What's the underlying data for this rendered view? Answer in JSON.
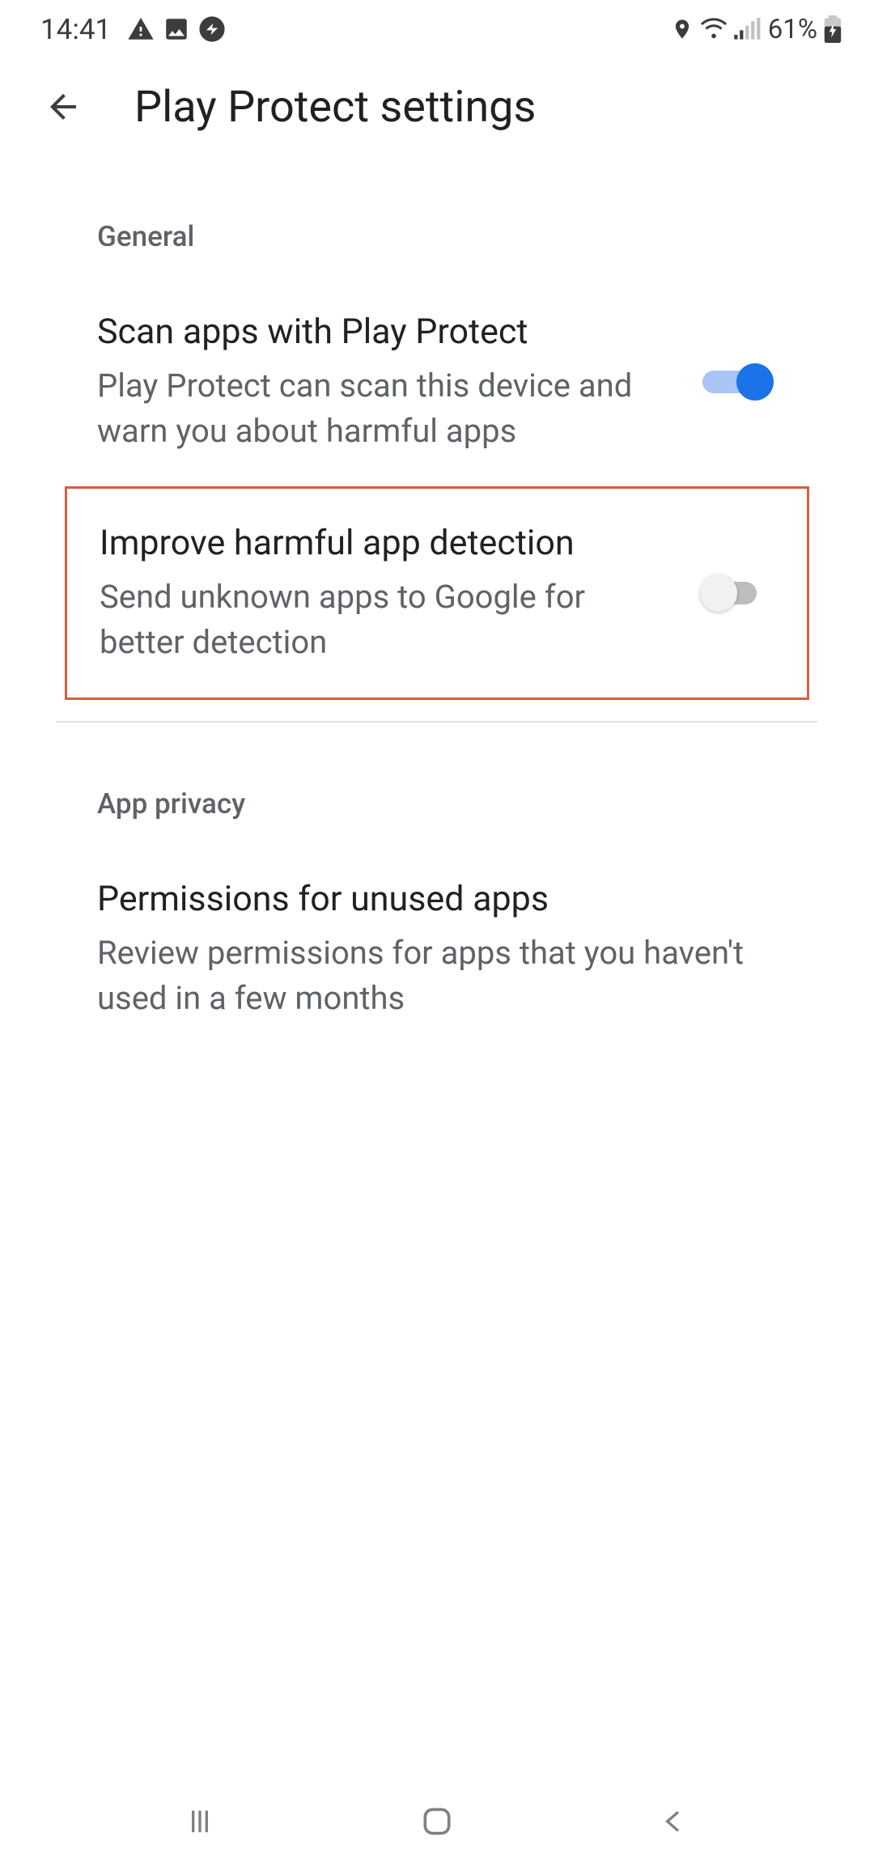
{
  "status_bar": {
    "time": "14:41",
    "battery": "61%"
  },
  "header": {
    "title": "Play Protect settings"
  },
  "sections": {
    "general": {
      "title": "General",
      "items": [
        {
          "title": "Scan apps with Play Protect",
          "description": "Play Protect can scan this device and warn you about harmful apps",
          "toggled": true
        },
        {
          "title": "Improve harmful app detection",
          "description": "Send unknown apps to Google for better detection",
          "toggled": false
        }
      ]
    },
    "app_privacy": {
      "title": "App privacy",
      "items": [
        {
          "title": "Permissions for unused apps",
          "description": "Review permissions for apps that you haven't used in a few months"
        }
      ]
    }
  }
}
